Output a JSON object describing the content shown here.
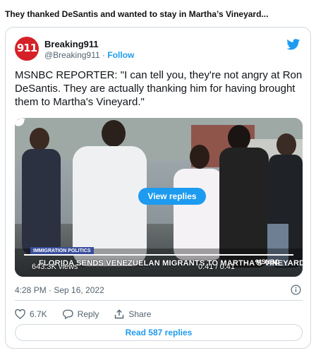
{
  "headline": "They thanked DeSantis and wanted to stay in Martha’s Vineyard...",
  "tweet": {
    "avatar_text": "911",
    "author_name": "Breaking911",
    "author_handle": "@Breaking911",
    "separator": "·",
    "follow_label": "Follow",
    "text": "MSNBC REPORTER: \"I can tell you, they're not angry at Ron DeSantis. They are actually thanking him for having brought them to Martha's Vineyard.\"",
    "timestamp": "4:28 PM · Sep 16, 2022",
    "likes": "6.7K",
    "reply_label": "Reply",
    "share_label": "Share",
    "read_replies_label": "Read 587 replies"
  },
  "video": {
    "view_replies_label": "View replies",
    "lower_third_tag": "IMMIGRATION POLITICS",
    "chyron": "FLORIDA SENDS VENEZUELAN MIGRANTS TO MARTHA'S VINEYARD",
    "views": "643.3K views",
    "time": "0:41 / 0:41",
    "network": "MSNBC",
    "progress": 1.0
  },
  "colors": {
    "accent": "#1d9bf0",
    "avatar_bg": "#d62027",
    "muted_text": "#536471",
    "border": "#cfd9de"
  },
  "icons": [
    "twitter-bird-icon",
    "replay-icon",
    "volume-icon",
    "expand-icon",
    "info-icon",
    "heart-icon",
    "reply-icon",
    "share-icon"
  ]
}
